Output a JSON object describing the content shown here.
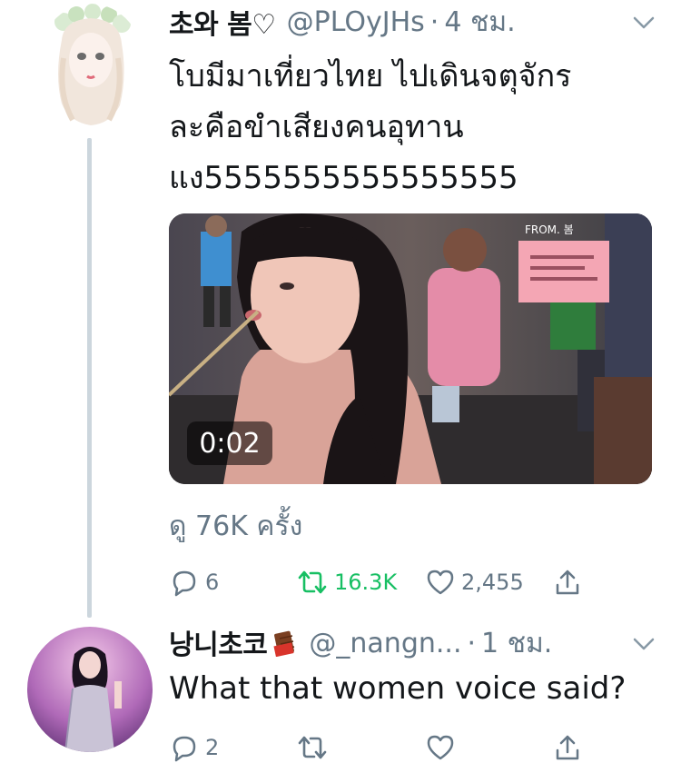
{
  "tweet": {
    "author_name": "초와 봄",
    "author_suffix": "♡",
    "handle": "@PLOyJHs",
    "separator": "·",
    "time": "4 ชม.",
    "text_lines": [
      "โบมีมาเที่ยวไทย ไปเดินจตุจักร",
      "ละคือขำเสียงคนอุทาน",
      "แง5555555555555555"
    ],
    "video_duration": "0:02",
    "views": "ดู 76K ครั้ง",
    "actions": {
      "replies": "6",
      "retweets": "16.3K",
      "likes": "2,455"
    },
    "icons": [
      "reply-icon",
      "retweet-icon",
      "like-icon",
      "share-icon",
      "chevron-down-icon"
    ],
    "retweet_color": "#17bf63"
  },
  "reply": {
    "author_name": "낭니초코",
    "author_emoji": "chocolate-icon",
    "handle": "@_nangn...",
    "separator": "·",
    "time": "1 ชม.",
    "text": "What that women voice said?",
    "actions": {
      "replies": "2"
    }
  },
  "colors": {
    "text": "#14171a",
    "muted": "#657786",
    "thread_line": "#ccd6dd",
    "retweet": "#17bf63"
  }
}
